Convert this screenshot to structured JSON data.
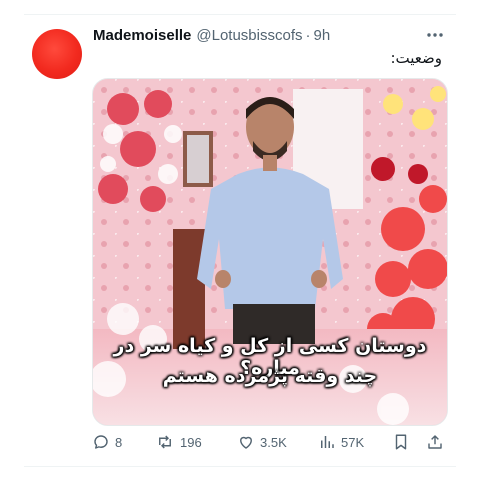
{
  "tweet": {
    "author_name": "Mademoiselle",
    "handle": "@Lotusbisscofs",
    "separator": "·",
    "time": "9h",
    "text": "وضعیت:",
    "image_caption_line1": "دوستان کسی از کل و کیاه سر در میاره؟",
    "image_caption_line2": "چند وقته پژمرده هستم",
    "avatar_color": "#f22a1f"
  },
  "actions": {
    "replies": "8",
    "retweets": "196",
    "likes": "3.5K",
    "views": "57K"
  },
  "icons": [
    "more-icon",
    "reply-icon",
    "retweet-icon",
    "like-icon",
    "views-icon",
    "bookmark-icon",
    "share-icon"
  ]
}
